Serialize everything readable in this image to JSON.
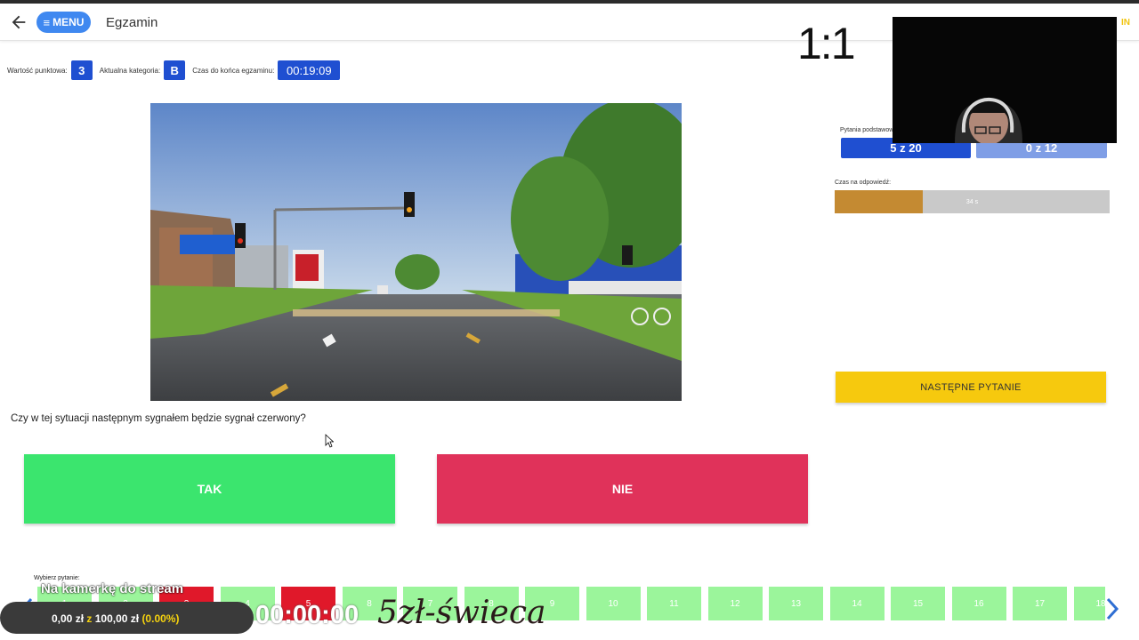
{
  "app": {
    "title": "Egzamin",
    "menu_label": "MENU",
    "corner_fragment": "IN"
  },
  "exam_info": {
    "points_label": "Wartość punktowa:",
    "points_value": "3",
    "category_label": "Aktualna kategoria:",
    "category_value": "B",
    "time_label": "Czas do końca egzaminu:",
    "time_value": "00:19:09"
  },
  "question": {
    "text": "Czy w tej sytuacji następnym sygnałem będzie sygnał czerwony?",
    "answer_yes": "TAK",
    "answer_no": "NIE"
  },
  "side": {
    "ratio_text": "1:1",
    "base_label": "Pytania podstawowe",
    "base_progress": "5 z 20",
    "specialist_progress": "0 z 12",
    "answer_time_label": "Czas na odpowiedź:",
    "answer_time_text": "34 s",
    "answer_time_fraction": 0.32,
    "next_button": "NASTĘPNE PYTANIE"
  },
  "nav": {
    "choose_label": "Wybierz pytanie:",
    "questions": [
      "1",
      "2",
      "3",
      "4",
      "5",
      "8",
      "7",
      "8",
      "9",
      "10",
      "11",
      "12",
      "13",
      "14",
      "15",
      "16",
      "17",
      "18"
    ],
    "wrong_indexes": [
      2,
      4
    ]
  },
  "overlay": {
    "title": "Na kamerkę do stream",
    "money_a": "0,00 zł",
    "money_sep": "z",
    "money_b": "100,00 zł",
    "money_pct": "(0.00%)",
    "clock": "00:00:00",
    "signature": "5zł-świeca"
  },
  "colors": {
    "primary": "#1f4fd1",
    "yes": "#3be56e",
    "no": "#e0325a",
    "next": "#f6c90e",
    "answered_wrong": "#e0182a",
    "unanswered": "#9bf59b"
  }
}
